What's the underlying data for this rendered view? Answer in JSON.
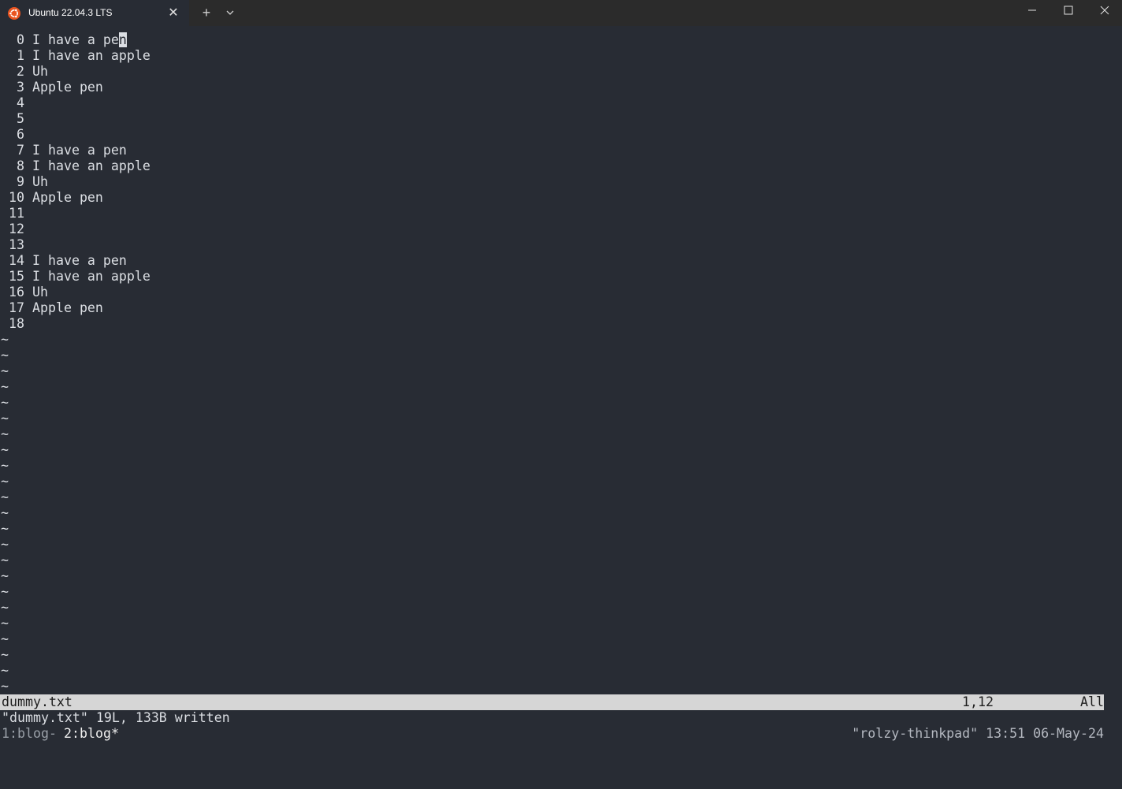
{
  "window": {
    "tab_title": "Ubuntu 22.04.3 LTS",
    "icons": {
      "tab_icon": "ubuntu-logo-icon",
      "close": "close-icon",
      "new_tab": "plus-icon",
      "dropdown": "chevron-down-icon",
      "minimize": "minimize-icon",
      "maximize": "maximize-icon",
      "window_close": "window-close-icon"
    },
    "colors": {
      "ubuntu_orange": "#e95420",
      "background": "#282c34",
      "statusline_bg": "#d6d6d6"
    }
  },
  "editor": {
    "lines": [
      {
        "num": "0",
        "text": "I have a pe",
        "cursor": "n"
      },
      {
        "num": "1",
        "text": "I have an apple"
      },
      {
        "num": "2",
        "text": "Uh"
      },
      {
        "num": "3",
        "text": "Apple pen"
      },
      {
        "num": "4",
        "text": ""
      },
      {
        "num": "5",
        "text": ""
      },
      {
        "num": "6",
        "text": ""
      },
      {
        "num": "7",
        "text": "I have a pen"
      },
      {
        "num": "8",
        "text": "I have an apple"
      },
      {
        "num": "9",
        "text": "Uh"
      },
      {
        "num": "10",
        "text": "Apple pen"
      },
      {
        "num": "11",
        "text": ""
      },
      {
        "num": "12",
        "text": ""
      },
      {
        "num": "13",
        "text": ""
      },
      {
        "num": "14",
        "text": "I have a pen"
      },
      {
        "num": "15",
        "text": "I have an apple"
      },
      {
        "num": "16",
        "text": "Uh"
      },
      {
        "num": "17",
        "text": "Apple pen"
      },
      {
        "num": "18",
        "text": ""
      }
    ],
    "tilde_char": "~",
    "tilde_count": 23
  },
  "statusline": {
    "filename": "dummy.txt",
    "position": "1,12",
    "scroll": "All"
  },
  "cmdline": {
    "message": "\"dummy.txt\" 19L, 133B written"
  },
  "tmux": {
    "window1": "1:blog-",
    "window2": "2:blog*",
    "right": "\"rolzy-thinkpad\" 13:51 06-May-24"
  }
}
